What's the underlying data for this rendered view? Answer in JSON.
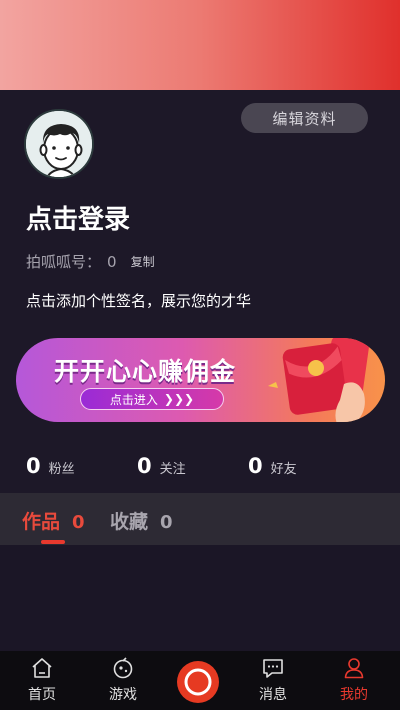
{
  "profile": {
    "edit_label": "编辑资料",
    "login_title": "点击登录",
    "account_label": "拍呱呱号：",
    "account_value": "0",
    "copy_label": "复制",
    "signature": "点击添加个性签名，展示您的才华"
  },
  "banner": {
    "title": "开开心心赚佣金",
    "button_label": "点击进入",
    "button_arrows": "❯❯❯"
  },
  "stats": [
    {
      "count": "0",
      "label": "粉丝"
    },
    {
      "count": "0",
      "label": "关注"
    },
    {
      "count": "0",
      "label": "好友"
    }
  ],
  "tabs": [
    {
      "label": "作品",
      "count": "0",
      "active": true
    },
    {
      "label": "收藏",
      "count": "0",
      "active": false
    }
  ],
  "nav": {
    "items": [
      {
        "label": "首页",
        "icon": "home-icon"
      },
      {
        "label": "游戏",
        "icon": "gamepad-icon"
      },
      {
        "label": "",
        "icon": "camera-record-icon"
      },
      {
        "label": "消息",
        "icon": "message-icon"
      },
      {
        "label": "我的",
        "icon": "user-icon",
        "active": true
      }
    ]
  },
  "colors": {
    "accent": "#e8392e",
    "background": "#1b1626",
    "tab_bar": "#2d2a34",
    "nav_bar": "#0d0c10"
  }
}
